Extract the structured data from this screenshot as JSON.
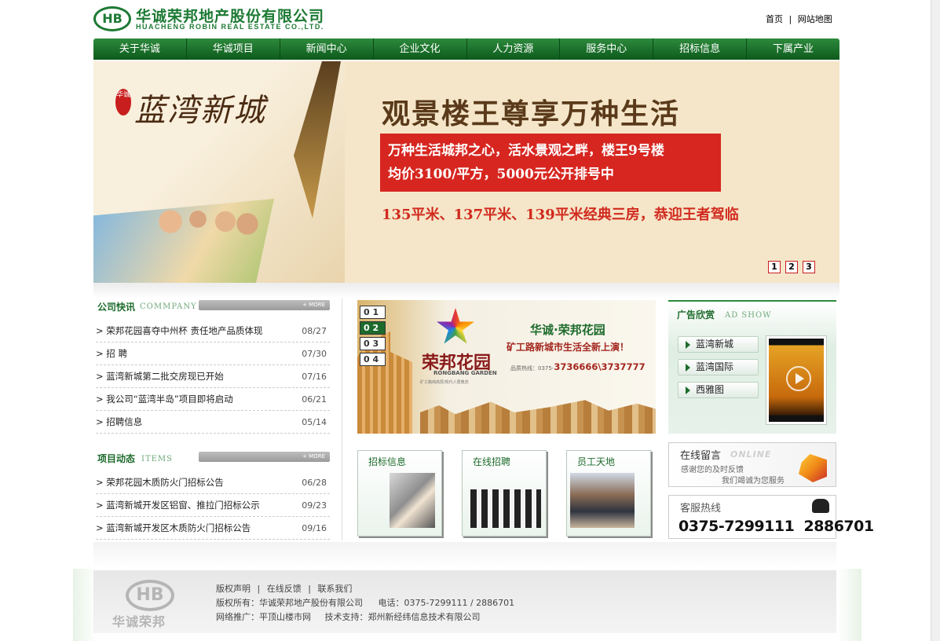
{
  "header": {
    "logo_cn": "华诚荣邦地产股份有限公司",
    "logo_en": "HUACHENG ROBIN REAL ESTATE CO.,LTD.",
    "logo_mark": "HB",
    "links": [
      "首页",
      "网站地图"
    ],
    "separator": "|"
  },
  "nav": [
    "关于华诚",
    "华诚项目",
    "新闻中心",
    "企业文化",
    "人力资源",
    "服务中心",
    "招标信息",
    "下属产业"
  ],
  "banner": {
    "brand": "蓝湾新城",
    "seal": "华诚",
    "headline": "观景楼王尊享万种生活",
    "box_line1": "万种生活城邦之心，活水景观之畔，楼王9号楼",
    "box_line2": "均价3100/平方，5000元公开排号中",
    "subline": "135平米、137平米、139平米经典三房，恭迎王者驾临",
    "pages": [
      "1",
      "2",
      "3"
    ]
  },
  "news": {
    "title": "公司快讯",
    "subtitle": "COMMPANY",
    "more": "+ MORE",
    "items": [
      {
        "text": "> 荣邦花园喜夺中州杯 责任地产品质体现",
        "date": "08/27"
      },
      {
        "text": "> 招 聘",
        "date": "07/30"
      },
      {
        "text": "> 蓝湾新城第二批交房现已开始",
        "date": "07/16"
      },
      {
        "text": "> 我公司“蓝湾半岛”项目即将启动",
        "date": "06/21"
      },
      {
        "text": "> 招聘信息",
        "date": "05/14"
      }
    ]
  },
  "projects": {
    "title": "项目动态",
    "subtitle": "ITEMS",
    "more": "+ MORE",
    "items": [
      {
        "text": "> 荣邦花园木质防火门招标公告",
        "date": "06/28"
      },
      {
        "text": "> 蓝湾新城开发区铝窗、推拉门招标公示",
        "date": "09/23"
      },
      {
        "text": "> 蓝湾新城开发区木质防火门招标公告",
        "date": "09/16"
      }
    ]
  },
  "promo": {
    "tabs": [
      "0 1",
      "0 2",
      "0 3",
      "0 4"
    ],
    "active_tab": 1,
    "name": "荣邦花园",
    "name_en": "RONGBANG GARDEN",
    "tagline": "矿工路纯高层/现代人居典范",
    "title1": "华诚·荣邦花园",
    "title2": "矿工路新城市生活全新上演！",
    "tel_label": "品质热线：0375-",
    "tel": "3736666\\3737777"
  },
  "tiles": [
    {
      "title": "招标信息"
    },
    {
      "title": "在线招聘"
    },
    {
      "title": "员工天地"
    }
  ],
  "ads": {
    "title": "广告欣赏",
    "subtitle": "AD  SHOW",
    "buttons": [
      "蓝湾新城",
      "蓝湾国际",
      "西雅图"
    ]
  },
  "message": {
    "title": "在线留言",
    "title_en": "ONLINE",
    "line1": "感谢您的及时反馈",
    "line2": "我们竭诚为您服务"
  },
  "hotline": {
    "title": "客服热线",
    "number": "0375-7299111  2886701"
  },
  "footer": {
    "logo_mark": "HB",
    "logo_cn": "华诚荣邦",
    "links": [
      "版权声明",
      "在线反馈",
      "联系我们"
    ],
    "separator": "|",
    "copyright": "版权所有：华诚荣邦地产股份有限公司",
    "phone": "电话：0375-7299111 / 2886701",
    "promo": "网络推广：平顶山楼市网",
    "support": "技术支持：郑州新经纬信息技术有限公司"
  },
  "colors": {
    "brand_green": "#1d6b2c",
    "nav_green": "#0d5a1c",
    "banner_red": "#d72620"
  }
}
